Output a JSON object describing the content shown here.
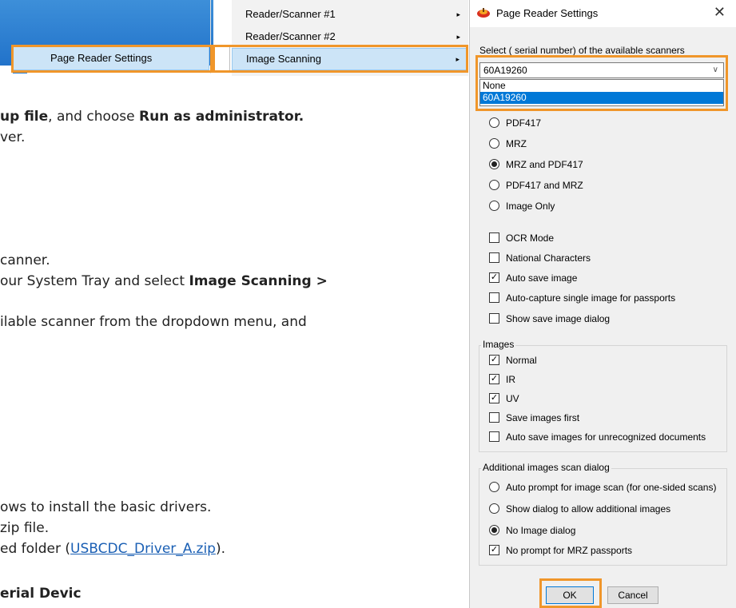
{
  "context_menu": {
    "left_item": "Page Reader Settings",
    "right_items": [
      {
        "label": "Reader/Scanner #1",
        "has_submenu": true
      },
      {
        "label": "Reader/Scanner #2",
        "has_submenu": true
      },
      {
        "label": "Image Scanning",
        "has_submenu": true
      }
    ],
    "submenu_arrow": "▸"
  },
  "document": {
    "line1_a": "up file",
    "line1_b": ", and choose ",
    "line1_c": "Run as administrator.",
    "line2": "ver.",
    "line3": "canner.",
    "line4_a": "our System Tray and select ",
    "line4_b": "Image Scanning >",
    "line5": "ilable scanner from the dropdown menu, and",
    "line6": "ows to install the basic drivers.",
    "line7": "zip file.",
    "line8_a": "ed folder (",
    "line8_link": "USBCDC_Driver_A.zip",
    "line8_b": ").",
    "line9": "erial Devic"
  },
  "dialog": {
    "title": "Page Reader Settings",
    "close_glyph": "✕",
    "select_label": "Select ( serial number) of  the available scanners",
    "select_value": "60A19260",
    "dropdown_options": [
      "None",
      "60A19260"
    ],
    "dropdown_selected_index": 1,
    "scan_modes": [
      {
        "label": "PDF417",
        "checked": false
      },
      {
        "label": "MRZ",
        "checked": false
      },
      {
        "label": "MRZ and PDF417",
        "checked": true
      },
      {
        "label": "PDF417 and MRZ",
        "checked": false
      },
      {
        "label": "Image Only",
        "checked": false
      }
    ],
    "options": [
      {
        "label": "OCR Mode",
        "checked": false
      },
      {
        "label": "National Characters",
        "checked": false
      },
      {
        "label": "Auto save image",
        "checked": true
      },
      {
        "label": "Auto-capture single image for passports",
        "checked": false
      },
      {
        "label": "Show save image dialog",
        "checked": false
      }
    ],
    "images_group": {
      "title": "Images",
      "items": [
        {
          "label": "Normal",
          "checked": true
        },
        {
          "label": "IR",
          "checked": true
        },
        {
          "label": "UV",
          "checked": true
        },
        {
          "label": "Save images first",
          "checked": false
        },
        {
          "label": "Auto save images for unrecognized documents",
          "checked": false
        }
      ]
    },
    "additional_group": {
      "title": "Additional images scan dialog",
      "radios": [
        {
          "label": "Auto prompt for image scan (for one-sided scans)",
          "checked": false
        },
        {
          "label": "Show dialog to allow additional images",
          "checked": false
        },
        {
          "label": "No Image dialog",
          "checked": true
        }
      ],
      "check": {
        "label": "No prompt for MRZ passports",
        "checked": true
      }
    },
    "ok_label": "OK",
    "cancel_label": "Cancel"
  },
  "colors": {
    "highlight": "#f0962a",
    "accent": "#0078d7"
  }
}
